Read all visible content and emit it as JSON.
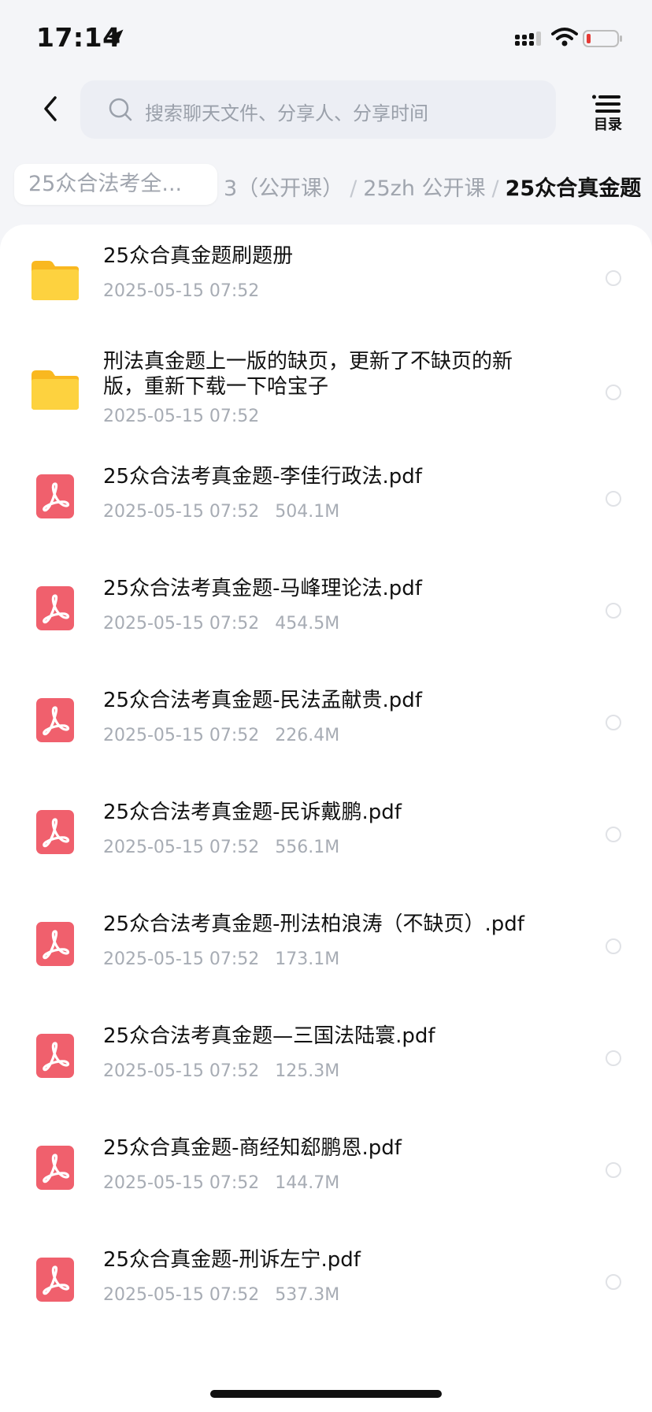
{
  "status_bar": {
    "time": "17:14",
    "battery_color": "#e53935"
  },
  "header": {
    "search_placeholder": "搜索聊天文件、分享人、分享时间",
    "toc_label": "目录"
  },
  "breadcrumb": {
    "first": "25众合法考全...",
    "partial": "3（公开课）",
    "middle": "25zh 公开课",
    "current": "25众合真金题"
  },
  "files": [
    {
      "type": "folder",
      "name": "25众合真金题刷题册",
      "date": "2025-05-15 07:52",
      "size": ""
    },
    {
      "type": "folder",
      "name": "刑法真金题上一版的缺页，更新了不缺页的新版，重新下载一下哈宝子",
      "date": "2025-05-15 07:52",
      "size": ""
    },
    {
      "type": "pdf",
      "name": "25众合法考真金题-李佳行政法.pdf",
      "date": "2025-05-15 07:52",
      "size": "504.1M"
    },
    {
      "type": "pdf",
      "name": "25众合法考真金题-马峰理论法.pdf",
      "date": "2025-05-15 07:52",
      "size": "454.5M"
    },
    {
      "type": "pdf",
      "name": "25众合法考真金题-民法孟献贵.pdf",
      "date": "2025-05-15 07:52",
      "size": "226.4M"
    },
    {
      "type": "pdf",
      "name": "25众合法考真金题-民诉戴鹏.pdf",
      "date": "2025-05-15 07:52",
      "size": "556.1M"
    },
    {
      "type": "pdf",
      "name": "25众合法考真金题-刑法柏浪涛（不缺页）.pdf",
      "date": "2025-05-15 07:52",
      "size": "173.1M"
    },
    {
      "type": "pdf",
      "name": "25众合法考真金题—三国法陆寰.pdf",
      "date": "2025-05-15 07:52",
      "size": "125.3M"
    },
    {
      "type": "pdf",
      "name": "25众合真金题-商经知郄鹏恩.pdf",
      "date": "2025-05-15 07:52",
      "size": "144.7M"
    },
    {
      "type": "pdf",
      "name": "25众合真金题-刑诉左宁.pdf",
      "date": "2025-05-15 07:52",
      "size": "537.3M"
    }
  ],
  "colors": {
    "folder": "#fbc531",
    "pdf": "#f0606d",
    "meta_text": "#a7acb4"
  }
}
